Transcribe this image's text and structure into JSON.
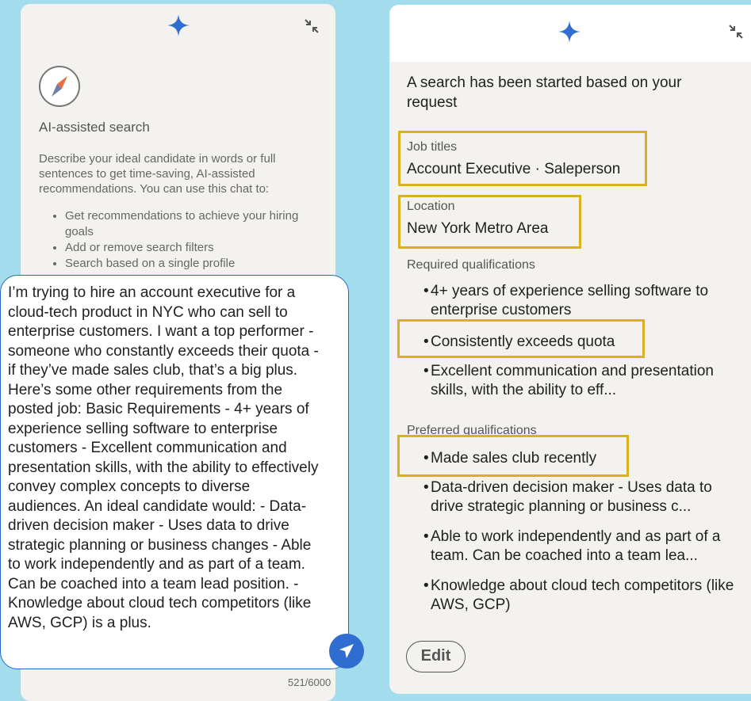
{
  "left": {
    "ai_title": "AI-assisted search",
    "ai_description": "Describe your ideal candidate in words or full sentences to get time-saving, AI-assisted recommendations. You can use this chat to:",
    "ai_list": [
      "Get recommendations to achieve your hiring goals",
      "Add or remove search filters",
      "Search based on a single profile"
    ],
    "prompt": "I’m trying to hire an account executive for a cloud-tech product in NYC who can sell to enterprise customers. I want a top performer - someone who constantly exceeds their quota - if they’ve made sales club, that’s a big plus. Here’s some other requirements from the posted job: Basic Requirements - 4+ years of experience selling software to enterprise customers - Excellent communication and presentation skills, with the ability to effectively convey complex concepts to diverse audiences. An ideal candidate would: - Data-driven decision maker - Uses data to drive strategic planning or business changes - Able to work independently and as part of a team. Can be coached into a team lead position. - Knowledge about cloud tech competitors (like AWS, GCP) is a plus.",
    "counter": "521/6000"
  },
  "right": {
    "intro": "A search has been started based on your request",
    "job_titles_label": "Job titles",
    "job_titles_value": "Account Executive · Saleperson",
    "location_label": "Location",
    "location_value": "New York Metro Area",
    "required_label": "Required qualifications",
    "required": [
      "4+ years of experience selling software to enterprise customers",
      "Consistently exceeds quota",
      "Excellent communication and presentation skills, with the ability to eff..."
    ],
    "preferred_label": "Preferred qualifications",
    "preferred": [
      "Made sales club recently",
      "Data-driven decision maker - Uses data to drive strategic planning or business c...",
      "Able to work independently and as part of a team. Can be coached into a team lea...",
      "Knowledge about cloud tech competitors (like AWS, GCP)"
    ],
    "edit_label": "Edit"
  },
  "icons": {
    "sparkle": "sparkle-icon",
    "collapse": "collapse-icon",
    "compass": "compass-icon",
    "send": "send-icon"
  },
  "colors": {
    "background": "#a3dcec",
    "accent_blue": "#2f6dd0",
    "highlight_yellow": "#d8b21f"
  }
}
